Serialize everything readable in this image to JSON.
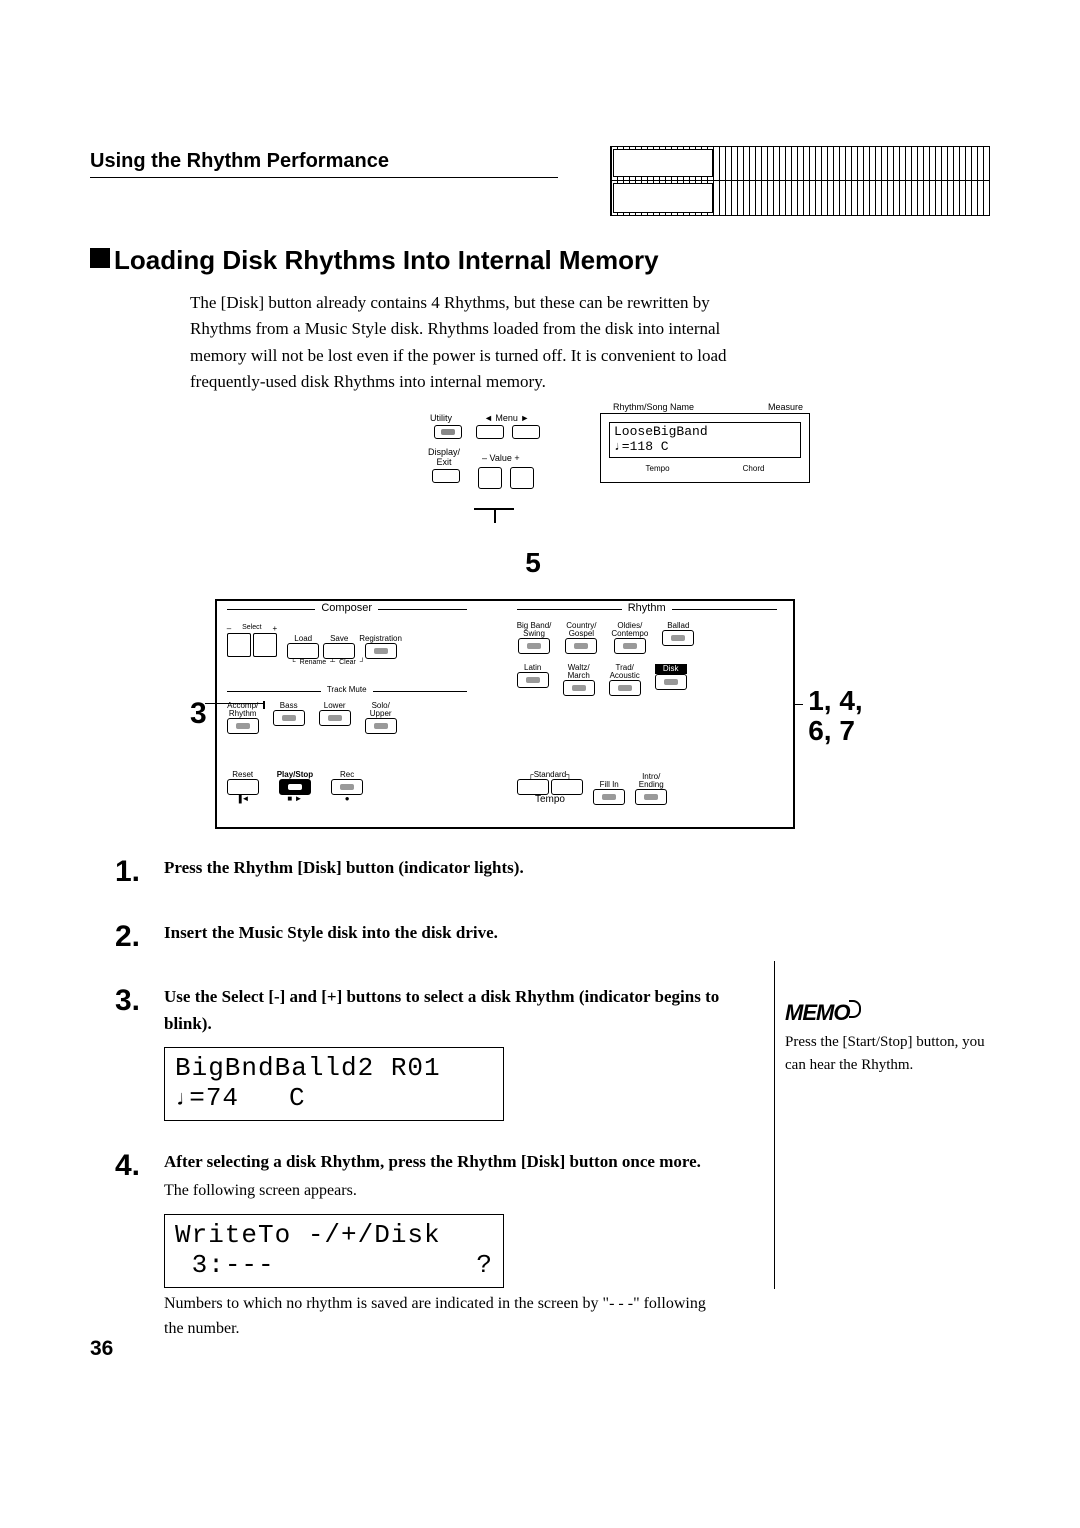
{
  "header": {
    "section": "Using the Rhythm Performance"
  },
  "heading": "Loading Disk Rhythms Into Internal Memory",
  "intro": "The [Disk] button already contains 4 Rhythms, but these can be rewritten by Rhythms from a Music Style disk. Rhythms loaded from the disk into internal memory will not be lost even if the power is turned off. It is convenient to load frequently-used disk Rhythms into internal memory.",
  "diagram1": {
    "labels": {
      "utility": "Utility",
      "menu": "◄ Menu ►",
      "display": "Display/\nExit",
      "value": "– Value +",
      "rhythm_song": "Rhythm/Song Name",
      "measure": "Measure",
      "tempo": "Tempo",
      "chord": "Chord",
      "lcd_line1": "LooseBigBand",
      "lcd_line2": "♩=118    C"
    },
    "callout": "5"
  },
  "diagram2": {
    "composer": "Composer",
    "rhythm": "Rhythm",
    "select": "Select",
    "minus": "–",
    "plus": "+",
    "load": "Load",
    "save": "Save",
    "registration": "Registration",
    "rename": "Rename",
    "clear": "Clear",
    "track_mute": "Track Mute",
    "accomp": "Accomp/\nRhythm",
    "bass": "Bass",
    "lower": "Lower",
    "solo": "Solo/\nUpper",
    "reset": "Reset",
    "playstop": "Play/Stop",
    "rec": "Rec",
    "bigband": "Big Band/\nSwing",
    "country": "Country/\nGospel",
    "oldies": "Oldies/\nContempo",
    "ballad": "Ballad",
    "latin": "Latin",
    "waltz": "Waltz/\nMarch",
    "trad": "Trad/\nAcoustic",
    "disk": "Disk",
    "standard": "Standard",
    "fillin": "Fill In",
    "intro": "Intro/\nEnding",
    "tempo": "Tempo",
    "left_callout": "3",
    "right_callout": "1, 4,\n6, 7"
  },
  "steps": [
    {
      "num": "1.",
      "lead": "Press the Rhythm [Disk] button (indicator lights)."
    },
    {
      "num": "2.",
      "lead": "Insert the Music Style disk into the disk drive."
    },
    {
      "num": "3.",
      "lead": "Use the Select [-] and [+] buttons to select a disk Rhythm (indicator begins to blink).",
      "lcd": {
        "line1": "BigBndBalld2 R01",
        "line2a": "74",
        "line2b": "C"
      }
    },
    {
      "num": "4.",
      "lead": "After selecting a disk Rhythm, press the Rhythm [Disk] button once more.",
      "plain1": "The following screen appears.",
      "lcd": {
        "line1": "WriteTo -/+/Disk",
        "line2a": "3:---",
        "line2b": "?"
      },
      "plain2": "Numbers to which no rhythm is saved are indicated in the screen by \"- - -\" following the number."
    }
  ],
  "memo": {
    "label": "MEMO",
    "text": "Press the [Start/Stop] button, you can hear the Rhythm."
  },
  "page_number": "36"
}
